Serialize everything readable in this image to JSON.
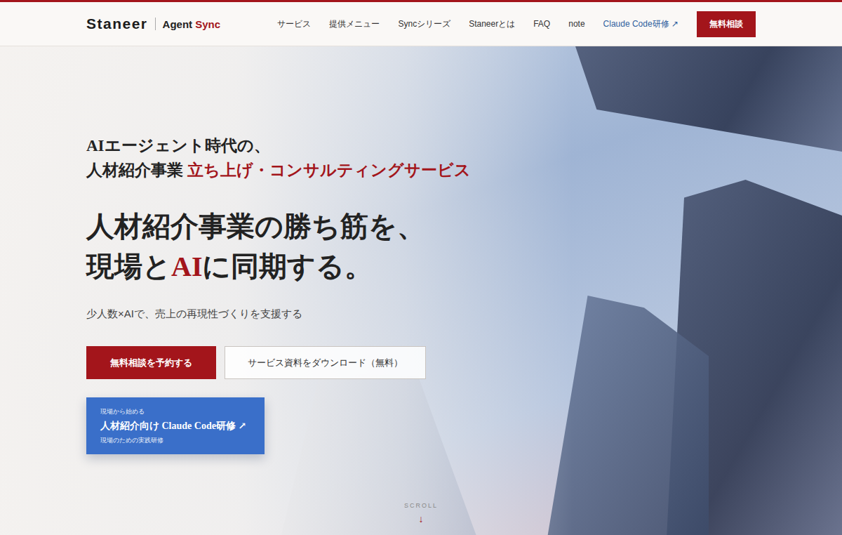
{
  "header": {
    "logo": "Staneer",
    "product": {
      "prefix": "Agent ",
      "accent": "Sync"
    },
    "nav": [
      {
        "label": "サービス",
        "kind": "link"
      },
      {
        "label": "提供メニュー",
        "kind": "link"
      },
      {
        "label": "Syncシリーズ",
        "kind": "link"
      },
      {
        "label": "Staneerとは",
        "kind": "link"
      },
      {
        "label": "FAQ",
        "kind": "link"
      },
      {
        "label": "note",
        "kind": "link"
      },
      {
        "label": "Claude Code研修 ↗",
        "kind": "external"
      }
    ],
    "cta": "無料相談"
  },
  "hero": {
    "eyebrow_lines": [
      [
        {
          "text": "AIエージェント時代の、",
          "accent": false
        }
      ],
      [
        {
          "text": "人材紹介事業 ",
          "accent": false
        },
        {
          "text": "立ち上げ・コンサルティングサービス",
          "accent": true
        }
      ]
    ],
    "headline_lines": [
      [
        {
          "text": "人材紹介事業の勝ち筋を、",
          "accent": false
        }
      ],
      [
        {
          "text": "現場と",
          "accent": false
        },
        {
          "text": "AI",
          "accent": true
        },
        {
          "text": "に同期する。",
          "accent": false
        }
      ]
    ],
    "subtitle": "少人数×AIで、売上の再現性づくりを支援する",
    "buttons": [
      {
        "label": "無料相談を予約する",
        "kind": "primary"
      },
      {
        "label": "サービス資料をダウンロード（無料）",
        "kind": "secondary"
      }
    ],
    "training_card": {
      "eyebrow": "現場から始める",
      "title": "人材紹介向け Claude Code研修 ↗",
      "caption": "現場のための実践研修"
    },
    "scroll": {
      "label": "SCROLL",
      "arrow": "↓"
    }
  }
}
